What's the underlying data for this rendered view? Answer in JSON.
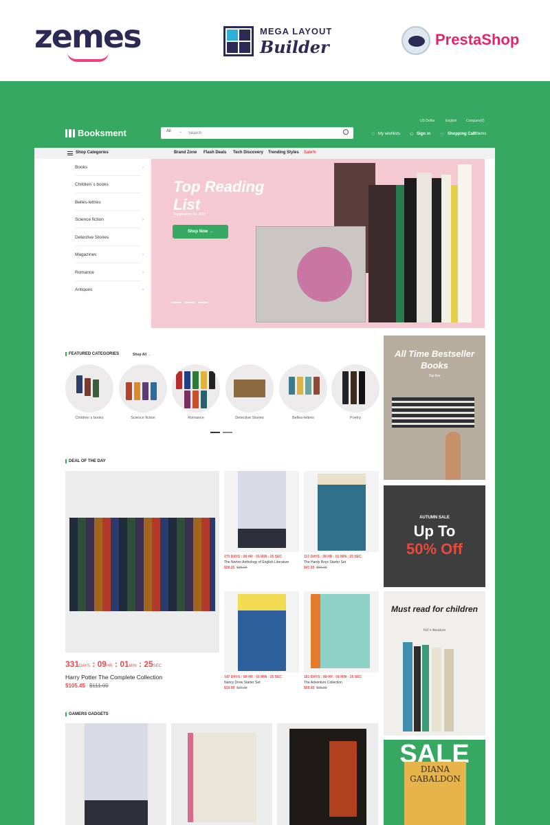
{
  "top_logos": {
    "zemes": "zemes",
    "mega_layout_line1": "MEGA LAYOUT",
    "mega_layout_line2": "Builder",
    "prestashop": "PrestaShop"
  },
  "colors": {
    "brand_green": "#36a862",
    "sale_red": "#e84a4a",
    "hero_pink": "#f5c9d1"
  },
  "header": {
    "brand": "Booksment",
    "utils": [
      "US Dollar",
      "English",
      "Compare(0)"
    ],
    "search": {
      "category": "All",
      "placeholder": "Search"
    },
    "wishlist": "My wishlists",
    "signin": "Sign in",
    "cart_label": "Shopping Cart:",
    "cart_count": "0 items"
  },
  "nav": {
    "shop_categories": "Shop Categories",
    "items": [
      "Brand Zone",
      "Flash Deals",
      "Tech Discovery",
      "Trending Styles",
      "Sale%"
    ]
  },
  "sidebar": {
    "items": [
      "Books",
      "Children`s books",
      "Belles-lettres",
      "Science fiction",
      "Detective Stories",
      "Magazines",
      "Romance",
      "Antiques"
    ]
  },
  "hero": {
    "title": "Top Reading List",
    "subtitle": "Suggestions for 2019",
    "button": "Shop Now"
  },
  "featured": {
    "title": "FEATURED CATEGORIES",
    "shop_all": "Shop All",
    "categories": [
      "Children`s books",
      "Science fiction",
      "Romance",
      "Detective Stories",
      "Belles-lettres",
      "Poetry"
    ]
  },
  "banners": {
    "bestseller_title": "All Time Bestseller Books",
    "bestseller_sub": "Top five",
    "autumn_small": "AUTUMN SALE",
    "autumn_big": "Up To",
    "autumn_red": "50% Off",
    "children_title": "Must read for children",
    "children_sub": "Kid`s literature",
    "sale": "SALE",
    "sale_book_line1": "DIANA",
    "sale_book_line2": "GABALDON"
  },
  "deal": {
    "title": "DEAL OF THE DAY",
    "main": {
      "timer": [
        {
          "v": "331",
          "u": "DAYS"
        },
        {
          "v": "09",
          "u": "HR"
        },
        {
          "v": "01",
          "u": "MIN"
        },
        {
          "v": "25",
          "u": "SEC"
        }
      ],
      "name": "Harry Potter The Complete Collection",
      "price": "$105.45",
      "old_price": "$111.00"
    },
    "cards": [
      {
        "timer": "270 DAYS : 08 HR : 01 MIN : 25 SEC",
        "name": "The Norton Anthology of English Literature",
        "price": "$28.25",
        "old": "$36.00"
      },
      {
        "timer": "117 DAYS : 08 HR : 01 MIN : 25 SEC",
        "name": "The Hardy Boys Starter Set",
        "price": "$47.50",
        "old": "$50.00"
      },
      {
        "timer": "147 DAYS : 08 HR : 01 MIN : 25 SEC",
        "name": "Nancy Drew Starter Set",
        "price": "$19.99",
        "old": "$27.00"
      },
      {
        "timer": "181 DAYS : 08 HR : 01 MIN : 25 SEC",
        "name": "The Adventure Collection",
        "price": "$59.45",
        "old": "$65.00"
      }
    ]
  },
  "gamers": {
    "title": "GAMERS GADGETS"
  }
}
